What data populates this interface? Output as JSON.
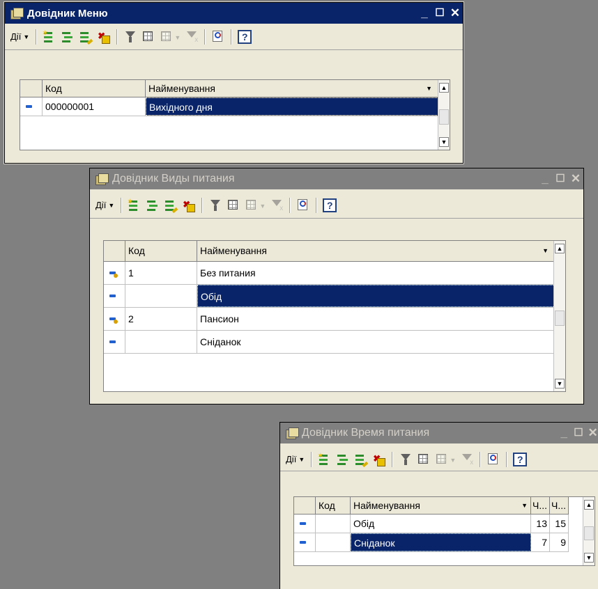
{
  "windows": {
    "menu": {
      "title": "Довідник Меню",
      "actions_label": "Дії",
      "columns": {
        "code": "Код",
        "name": "Найменування"
      },
      "rows": [
        {
          "code": "000000001",
          "name": "Вихідного дня"
        }
      ]
    },
    "food_types": {
      "title": "Довідник Виды питания",
      "actions_label": "Дії",
      "columns": {
        "code": "Код",
        "name": "Найменування"
      },
      "rows": [
        {
          "code": "1",
          "name": "Без питания"
        },
        {
          "code": "",
          "name": "Обід"
        },
        {
          "code": "2",
          "name": "Пансион"
        },
        {
          "code": "",
          "name": "Сніданок"
        }
      ]
    },
    "meal_time": {
      "title": "Довідник Время питания",
      "actions_label": "Дії",
      "columns": {
        "code": "Код",
        "name": "Найменування",
        "from": "Ч...",
        "to": "Ч..."
      },
      "rows": [
        {
          "code": "",
          "name": "Обід",
          "from": "13",
          "to": "15"
        },
        {
          "code": "",
          "name": "Сніданок",
          "from": "7",
          "to": "9"
        }
      ]
    }
  },
  "colors": {
    "active_title": "#0a246a",
    "inactive_title": "#808080",
    "selection": "#0a246a",
    "desktop": "#808080"
  },
  "icons": [
    "app-icon",
    "minimize-icon",
    "maximize-icon",
    "close-icon",
    "add-icon",
    "add-group-icon",
    "edit-icon",
    "delete-icon",
    "filter-icon",
    "filter-table-icon",
    "filter-list-icon",
    "clear-filter-icon",
    "refresh-icon",
    "help-icon",
    "element-marker-icon",
    "group-marker-icon"
  ]
}
